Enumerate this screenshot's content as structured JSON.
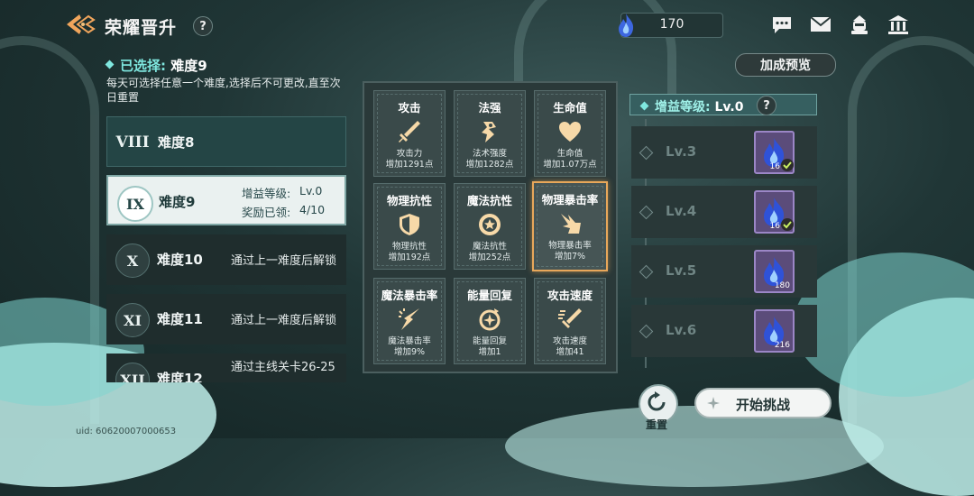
{
  "header": {
    "title": "荣耀晋升",
    "help_label": "?",
    "currency_value": "170"
  },
  "selection": {
    "label": "已选择: ",
    "value": "难度9",
    "description": "每天可选择任意一个难度,选择后不可更改,直至次日重置"
  },
  "difficulties": [
    {
      "roman": "VIII",
      "name": "难度8",
      "note": ""
    },
    {
      "roman": "IX",
      "name": "难度9",
      "buff_label": "增益等级:",
      "buff_value": "Lv.0",
      "reward_label": "奖励已领:",
      "reward_value": "4/10"
    },
    {
      "roman": "X",
      "name": "难度10",
      "note": "通过上一难度后解锁"
    },
    {
      "roman": "XI",
      "name": "难度11",
      "note": "通过上一难度后解锁"
    },
    {
      "roman": "XII",
      "name": "难度12",
      "note": "通过主线关卡26-25"
    }
  ],
  "stats": [
    {
      "name": "攻击",
      "line1": "攻击力",
      "line2": "增加1291点",
      "icon": "sword-icon"
    },
    {
      "name": "法强",
      "line1": "法术强度",
      "line2": "增加1282点",
      "icon": "magic-power-icon"
    },
    {
      "name": "生命值",
      "line1": "生命值",
      "line2": "增加1.07万点",
      "icon": "heart-icon"
    },
    {
      "name": "物理抗性",
      "line1": "物理抗性",
      "line2": "增加192点",
      "icon": "shield-icon"
    },
    {
      "name": "魔法抗性",
      "line1": "魔法抗性",
      "line2": "增加252点",
      "icon": "magic-shield-icon"
    },
    {
      "name": "物理暴击率",
      "line1": "物理暴击率",
      "line2": "增加7%",
      "icon": "physical-crit-icon"
    },
    {
      "name": "魔法暴击率",
      "line1": "魔法暴击率",
      "line2": "增加9%",
      "icon": "magic-crit-icon"
    },
    {
      "name": "能量回复",
      "line1": "能量回复",
      "line2": "增加1",
      "icon": "energy-regen-icon"
    },
    {
      "name": "攻击速度",
      "line1": "攻击速度",
      "line2": "增加41",
      "icon": "attack-speed-icon"
    }
  ],
  "buff_panel": {
    "label": "增益等级: ",
    "value": "Lv.0",
    "levels": [
      {
        "level": "Lv.3",
        "reward_count": "16",
        "claimed": true
      },
      {
        "level": "Lv.4",
        "reward_count": "16",
        "claimed": true
      },
      {
        "level": "Lv.5",
        "reward_count": "180",
        "claimed": false
      },
      {
        "level": "Lv.6",
        "reward_count": "216",
        "claimed": false
      }
    ]
  },
  "buttons": {
    "preview": "加成预览",
    "reset": "重置",
    "start": "开始挑战"
  },
  "footer": {
    "uid": "uid: 60620007000653"
  },
  "colors": {
    "accent": "#7fe7df",
    "highlight_border": "#e8a75a",
    "reward_bg": "#5b4c7a"
  }
}
